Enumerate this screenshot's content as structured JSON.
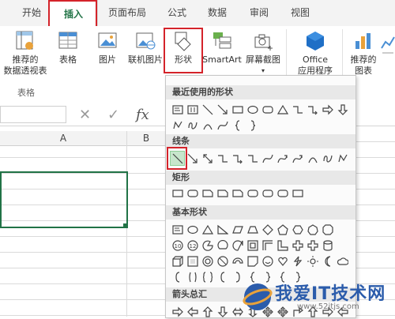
{
  "tabs": [
    "开始",
    "插入",
    "页面布局",
    "公式",
    "数据",
    "审阅",
    "视图"
  ],
  "ribbon": {
    "pivot_label_1": "推荐的",
    "pivot_label_2": "数据透视表",
    "table_label": "表格",
    "picture_label": "图片",
    "online_picture_label": "联机图片",
    "shapes_label": "形状",
    "smartart_label": "SmartArt",
    "screenshot_label": "屏幕截图",
    "office_label_1": "Office",
    "office_label_2": "应用程序",
    "rec_chart_label_1": "推荐的",
    "rec_chart_label_2": "图表",
    "group_table": "表格"
  },
  "formula_bar": {
    "cancel": "✕",
    "enter": "✓",
    "fx": "fx"
  },
  "columns": [
    "A",
    "B"
  ],
  "shapes_panel": {
    "sections": [
      "最近使用的形状",
      "线条",
      "矩形",
      "基本形状",
      "箭头总汇"
    ]
  },
  "watermark": {
    "text": "我爱IT技术网",
    "url": "www.52itjs.com"
  },
  "colors": {
    "accent": "#217346",
    "highlight": "#d4232a",
    "selected_shape": "#c7e6cc"
  }
}
